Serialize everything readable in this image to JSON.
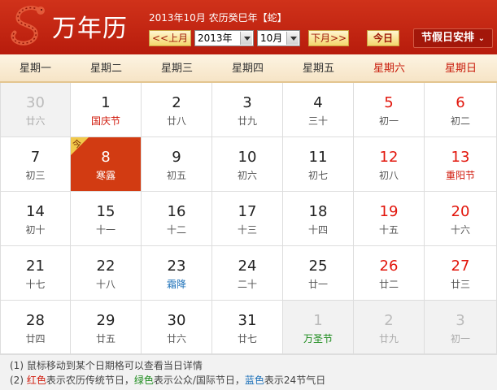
{
  "header": {
    "title": "万年历",
    "subtitle": "2013年10月 农历癸巳年【蛇】",
    "prev_month": "<<上月",
    "year_value": "2013年",
    "month_value": "10月",
    "next_month": "下月>>",
    "today": "今日",
    "holiday_schedule": "节假日安排",
    "colors": {
      "header_bg": "#c22a12",
      "today_cell": "#d23b12"
    }
  },
  "weekdays": [
    "星期一",
    "星期二",
    "星期三",
    "星期四",
    "星期五",
    "星期六",
    "星期日"
  ],
  "today_badge": "今",
  "weeks": [
    [
      {
        "day": "30",
        "lunar": "廿六",
        "other": true
      },
      {
        "day": "1",
        "lunar": "国庆节",
        "lunar_color": "red"
      },
      {
        "day": "2",
        "lunar": "廿八"
      },
      {
        "day": "3",
        "lunar": "廿九"
      },
      {
        "day": "4",
        "lunar": "三十"
      },
      {
        "day": "5",
        "lunar": "初一",
        "weekend": true
      },
      {
        "day": "6",
        "lunar": "初二",
        "weekend": true
      }
    ],
    [
      {
        "day": "7",
        "lunar": "初三"
      },
      {
        "day": "8",
        "lunar": "寒露",
        "today": true
      },
      {
        "day": "9",
        "lunar": "初五"
      },
      {
        "day": "10",
        "lunar": "初六"
      },
      {
        "day": "11",
        "lunar": "初七"
      },
      {
        "day": "12",
        "lunar": "初八",
        "weekend": true
      },
      {
        "day": "13",
        "lunar": "重阳节",
        "weekend": true,
        "lunar_color": "red"
      }
    ],
    [
      {
        "day": "14",
        "lunar": "初十"
      },
      {
        "day": "15",
        "lunar": "十一"
      },
      {
        "day": "16",
        "lunar": "十二"
      },
      {
        "day": "17",
        "lunar": "十三"
      },
      {
        "day": "18",
        "lunar": "十四"
      },
      {
        "day": "19",
        "lunar": "十五",
        "weekend": true
      },
      {
        "day": "20",
        "lunar": "十六",
        "weekend": true
      }
    ],
    [
      {
        "day": "21",
        "lunar": "十七"
      },
      {
        "day": "22",
        "lunar": "十八"
      },
      {
        "day": "23",
        "lunar": "霜降",
        "lunar_color": "blue"
      },
      {
        "day": "24",
        "lunar": "二十"
      },
      {
        "day": "25",
        "lunar": "廿一"
      },
      {
        "day": "26",
        "lunar": "廿二",
        "weekend": true
      },
      {
        "day": "27",
        "lunar": "廿三",
        "weekend": true
      }
    ],
    [
      {
        "day": "28",
        "lunar": "廿四"
      },
      {
        "day": "29",
        "lunar": "廿五"
      },
      {
        "day": "30",
        "lunar": "廿六"
      },
      {
        "day": "31",
        "lunar": "廿七"
      },
      {
        "day": "1",
        "lunar": "万圣节",
        "other": true,
        "lunar_color": "green"
      },
      {
        "day": "2",
        "lunar": "廿九",
        "other": true
      },
      {
        "day": "3",
        "lunar": "初一",
        "other": true
      }
    ]
  ],
  "footer": {
    "line1": "(1) 鼠标移动到某个日期格可以查看当日详情",
    "line2_prefix": "(2) ",
    "red_word": "红色",
    "red_text": "表示农历传统节日，",
    "green_word": "绿色",
    "green_text": "表示公众/国际节日，",
    "blue_word": "蓝色",
    "blue_text": "表示24节气日"
  }
}
